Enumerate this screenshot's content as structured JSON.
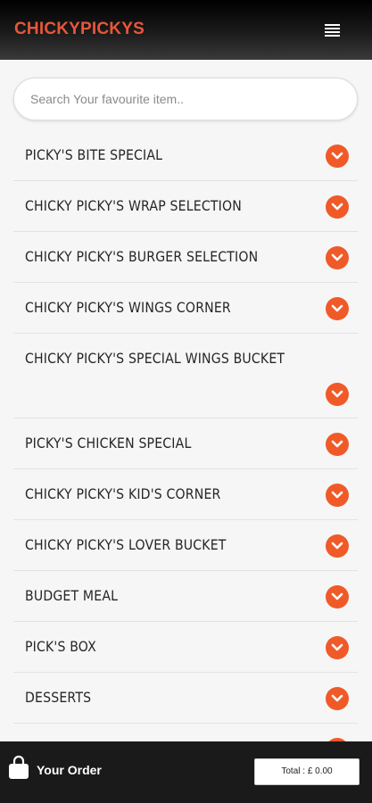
{
  "header": {
    "brand": "CHICKYPICKYS",
    "menu_icon": "hamburger-menu-icon"
  },
  "search": {
    "placeholder": "Search Your favourite item..",
    "value": ""
  },
  "menu": {
    "items": [
      {
        "label": "PICKY'S BITE SPECIAL"
      },
      {
        "label": "CHICKY PICKY'S WRAP SELECTION"
      },
      {
        "label": "CHICKY PICKY'S BURGER SELECTION"
      },
      {
        "label": "CHICKY PICKY'S WINGS CORNER"
      },
      {
        "label": "CHICKY PICKY'S SPECIAL WINGS BUCKET"
      },
      {
        "label": "PICKY'S CHICKEN SPECIAL"
      },
      {
        "label": "CHICKY PICKY'S KID'S CORNER"
      },
      {
        "label": "CHICKY PICKY'S LOVER BUCKET"
      },
      {
        "label": "BUDGET MEAL"
      },
      {
        "label": "PICK'S BOX"
      },
      {
        "label": "DESSERTS"
      },
      {
        "label": ""
      }
    ],
    "expand_icon": "chevron-down-icon"
  },
  "footer": {
    "order_label": "Your Order",
    "total_label": "Total : £ 0.00",
    "bag_icon": "shopping-bag-icon"
  },
  "colors": {
    "brand": "#e8563a",
    "accent": "#f05a28",
    "header_bg": "#000000",
    "footer_bg": "#1a1a1a",
    "page_bg": "#f6f6f6"
  }
}
